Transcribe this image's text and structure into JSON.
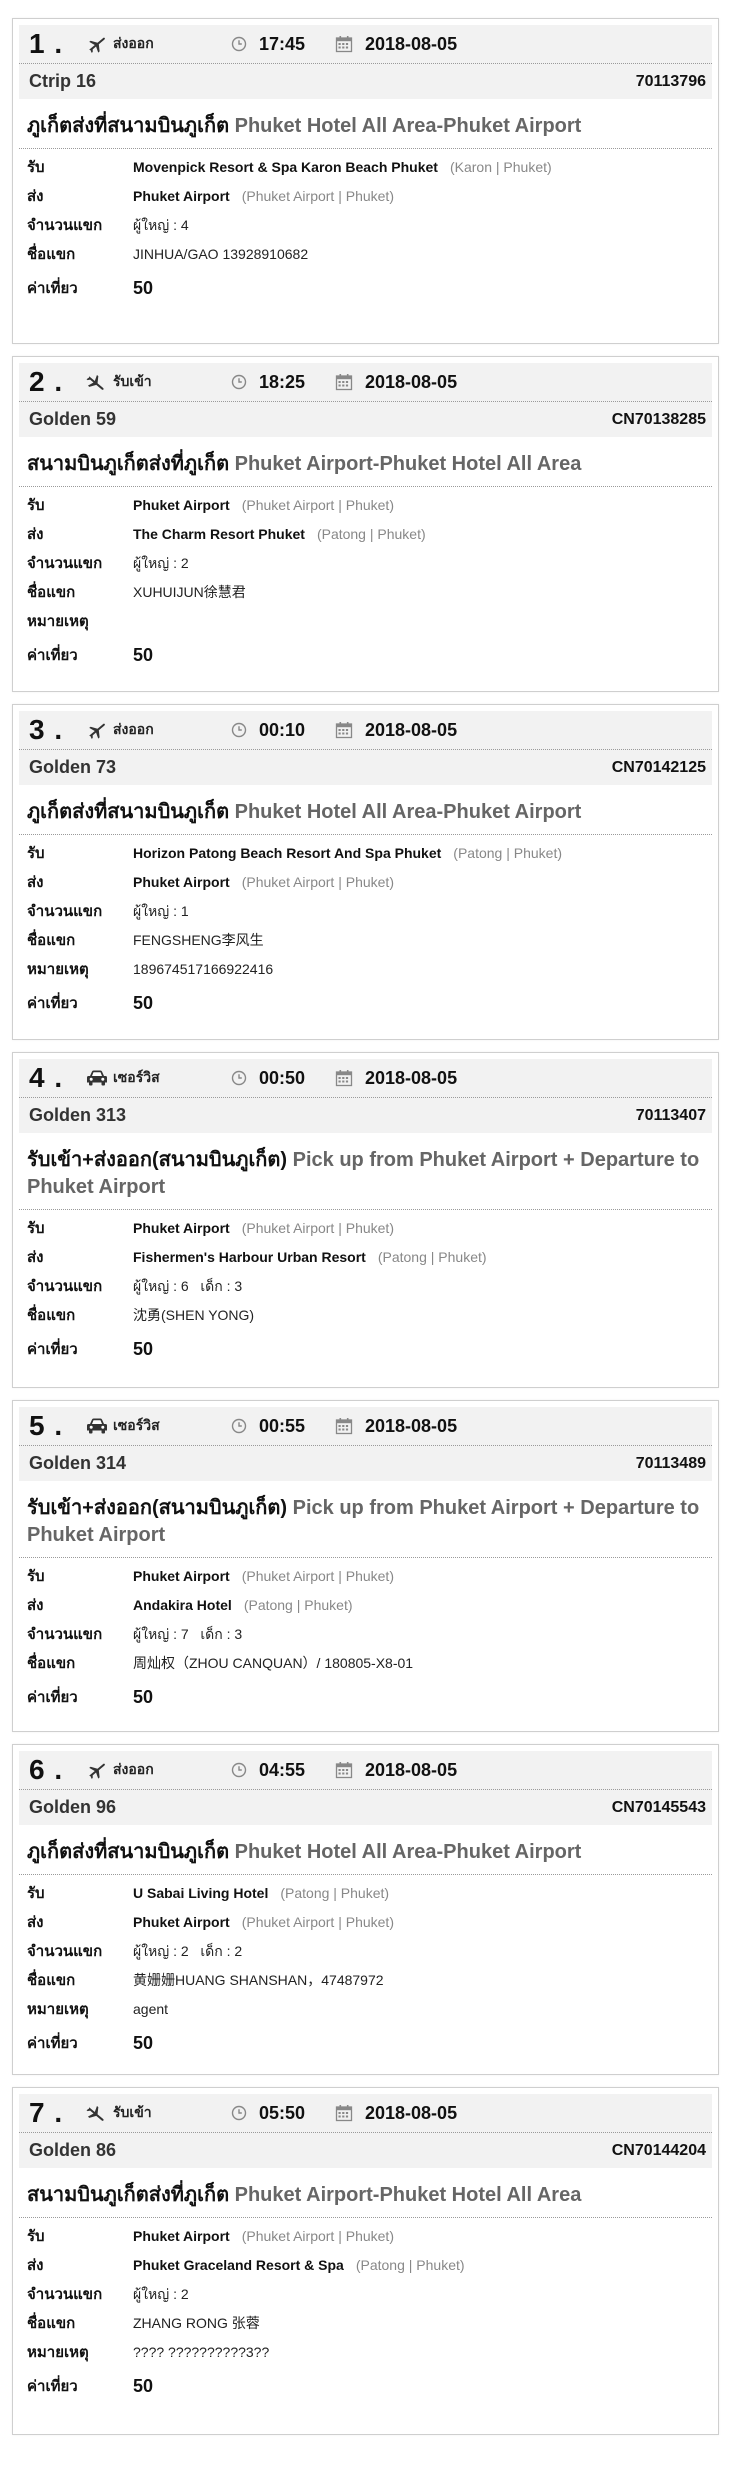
{
  "jobs": [
    {
      "number": "1",
      "service_icon": "plane-departure-icon",
      "service": "ส่งออก",
      "time": "17:45",
      "date": "2018-08-05",
      "driver": "Ctrip 16",
      "code": "70113796",
      "route_th": "ภูเก็ตส่งที่สนามบินภูเก็ต",
      "route_en": "Phuket Hotel All Area-Phuket Airport",
      "rows": [
        {
          "label": "รับ",
          "main": "Movenpick Resort & Spa Karon Beach Phuket",
          "sub": "(Karon | Phuket)",
          "bold": true
        },
        {
          "label": "ส่ง",
          "main": "Phuket Airport",
          "sub": "(Phuket Airport | Phuket)",
          "bold": true
        },
        {
          "label": "จำนวนแขก",
          "main": "ผู้ใหญ่ : 4",
          "sub": "",
          "bold": false
        },
        {
          "label": "ชื่อแขก",
          "main": "JINHUA/GAO 13928910682",
          "sub": "",
          "bold": false
        }
      ],
      "fare_label": "ค่าเที่ยว",
      "fare": "50"
    },
    {
      "number": "2",
      "service_icon": "plane-arrival-icon",
      "service": "รับเข้า",
      "time": "18:25",
      "date": "2018-08-05",
      "driver": "Golden 59",
      "code": "CN70138285",
      "route_th": "สนามบินภูเก็ตส่งที่ภูเก็ต",
      "route_en": "Phuket Airport-Phuket Hotel All Area",
      "rows": [
        {
          "label": "รับ",
          "main": "Phuket Airport",
          "sub": "(Phuket Airport | Phuket)",
          "bold": true
        },
        {
          "label": "ส่ง",
          "main": "The Charm Resort Phuket",
          "sub": "(Patong | Phuket)",
          "bold": true
        },
        {
          "label": "จำนวนแขก",
          "main": "ผู้ใหญ่ : 2",
          "sub": "",
          "bold": false
        },
        {
          "label": "ชื่อแขก",
          "main": "XUHUIJUN徐慧君",
          "sub": "",
          "bold": false
        },
        {
          "label": "หมายเหตุ",
          "main": "",
          "sub": "",
          "bold": false
        }
      ],
      "fare_label": "ค่าเที่ยว",
      "fare": "50"
    },
    {
      "number": "3",
      "service_icon": "plane-departure-icon",
      "service": "ส่งออก",
      "time": "00:10",
      "date": "2018-08-05",
      "driver": "Golden 73",
      "code": "CN70142125",
      "route_th": "ภูเก็ตส่งที่สนามบินภูเก็ต",
      "route_en": "Phuket Hotel All Area-Phuket Airport",
      "rows": [
        {
          "label": "รับ",
          "main": "Horizon Patong Beach Resort And Spa Phuket",
          "sub": "(Patong | Phuket)",
          "bold": true
        },
        {
          "label": "ส่ง",
          "main": "Phuket Airport",
          "sub": "(Phuket Airport | Phuket)",
          "bold": true
        },
        {
          "label": "จำนวนแขก",
          "main": "ผู้ใหญ่ : 1",
          "sub": "",
          "bold": false
        },
        {
          "label": "ชื่อแขก",
          "main": "FENGSHENG李风生",
          "sub": "",
          "bold": false
        },
        {
          "label": "หมายเหตุ",
          "main": "189674517166922416",
          "sub": "",
          "bold": false
        }
      ],
      "fare_label": "ค่าเที่ยว",
      "fare": "50"
    },
    {
      "number": "4",
      "service_icon": "car-icon",
      "service": "เซอร์วิส",
      "time": "00:50",
      "date": "2018-08-05",
      "driver": "Golden 313",
      "code": "70113407",
      "route_th": "รับเข้า+ส่งออก(สนามบินภูเก็ต)",
      "route_en": "Pick up from Phuket Airport + Departure to Phuket Airport",
      "rows": [
        {
          "label": "รับ",
          "main": "Phuket Airport",
          "sub": "(Phuket Airport | Phuket)",
          "bold": true
        },
        {
          "label": "ส่ง",
          "main": "Fishermen's Harbour Urban Resort",
          "sub": "(Patong | Phuket)",
          "bold": true
        },
        {
          "label": "จำนวนแขก",
          "main": "ผู้ใหญ่ : 6   เด็ก : 3",
          "sub": "",
          "bold": false
        },
        {
          "label": "ชื่อแขก",
          "main": "沈勇(SHEN YONG)",
          "sub": "",
          "bold": false
        }
      ],
      "fare_label": "ค่าเที่ยว",
      "fare": "50"
    },
    {
      "number": "5",
      "service_icon": "car-icon",
      "service": "เซอร์วิส",
      "time": "00:55",
      "date": "2018-08-05",
      "driver": "Golden 314",
      "code": "70113489",
      "route_th": "รับเข้า+ส่งออก(สนามบินภูเก็ต)",
      "route_en": "Pick up from Phuket Airport + Departure to Phuket Airport",
      "rows": [
        {
          "label": "รับ",
          "main": "Phuket Airport",
          "sub": "(Phuket Airport | Phuket)",
          "bold": true
        },
        {
          "label": "ส่ง",
          "main": "Andakira Hotel",
          "sub": "(Patong | Phuket)",
          "bold": true
        },
        {
          "label": "จำนวนแขก",
          "main": "ผู้ใหญ่ : 7   เด็ก : 3",
          "sub": "",
          "bold": false
        },
        {
          "label": "ชื่อแขก",
          "main": "周灿权（ZHOU CANQUAN）/ 180805-X8-01",
          "sub": "",
          "bold": false
        }
      ],
      "fare_label": "ค่าเที่ยว",
      "fare": "50"
    },
    {
      "number": "6",
      "service_icon": "plane-departure-icon",
      "service": "ส่งออก",
      "time": "04:55",
      "date": "2018-08-05",
      "driver": "Golden 96",
      "code": "CN70145543",
      "route_th": "ภูเก็ตส่งที่สนามบินภูเก็ต",
      "route_en": "Phuket Hotel All Area-Phuket Airport",
      "rows": [
        {
          "label": "รับ",
          "main": "U Sabai Living Hotel",
          "sub": "(Patong | Phuket)",
          "bold": true
        },
        {
          "label": "ส่ง",
          "main": "Phuket Airport",
          "sub": "(Phuket Airport | Phuket)",
          "bold": true
        },
        {
          "label": "จำนวนแขก",
          "main": "ผู้ใหญ่ : 2   เด็ก : 2",
          "sub": "",
          "bold": false
        },
        {
          "label": "ชื่อแขก",
          "main": "黄姗姗HUANG SHANSHAN，47487972",
          "sub": "",
          "bold": false
        },
        {
          "label": "หมายเหตุ",
          "main": "agent",
          "sub": "",
          "bold": false
        }
      ],
      "fare_label": "ค่าเที่ยว",
      "fare": "50"
    },
    {
      "number": "7",
      "service_icon": "plane-arrival-icon",
      "service": "รับเข้า",
      "time": "05:50",
      "date": "2018-08-05",
      "driver": "Golden 86",
      "code": "CN70144204",
      "route_th": "สนามบินภูเก็ตส่งที่ภูเก็ต",
      "route_en": "Phuket Airport-Phuket Hotel All Area",
      "rows": [
        {
          "label": "รับ",
          "main": "Phuket Airport",
          "sub": "(Phuket Airport | Phuket)",
          "bold": true
        },
        {
          "label": "ส่ง",
          "main": "Phuket Graceland Resort & Spa",
          "sub": "(Patong | Phuket)",
          "bold": true
        },
        {
          "label": "จำนวนแขก",
          "main": "ผู้ใหญ่ : 2",
          "sub": "",
          "bold": false
        },
        {
          "label": "ชื่อแขก",
          "main": "ZHANG RONG 张蓉",
          "sub": "",
          "bold": false
        },
        {
          "label": "หมายเหตุ",
          "main": "???? ??????????3??",
          "sub": "",
          "bold": false
        }
      ],
      "fare_label": "ค่าเที่ยว",
      "fare": "50"
    }
  ]
}
